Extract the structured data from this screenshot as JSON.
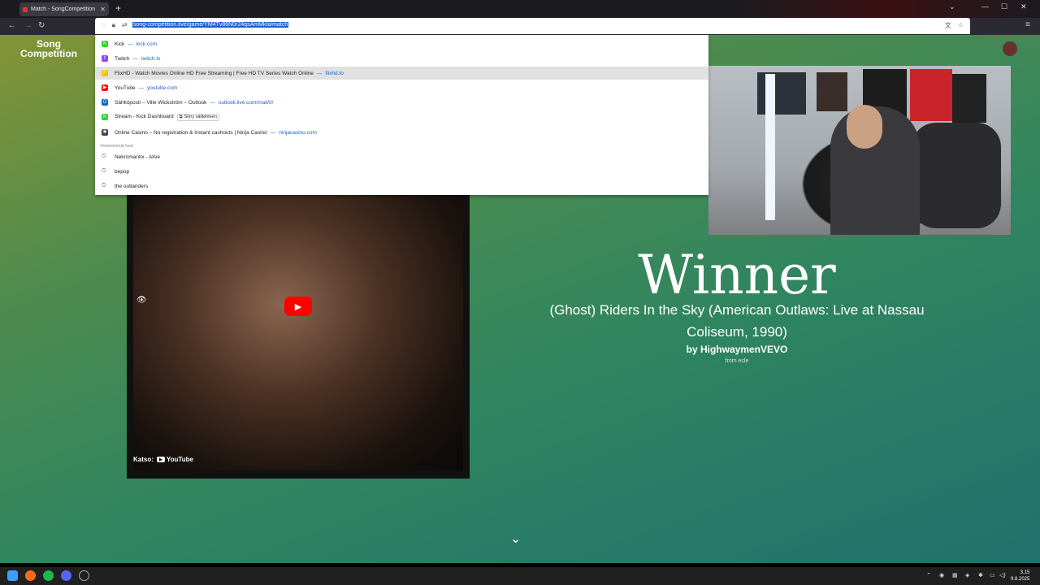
{
  "browser": {
    "tab_title": "Match - SongCompetition",
    "new_tab_symbol": "+",
    "url": "song-competition.live/game/YM4Tv86N0r24qsAmMkfa/match"
  },
  "site": {
    "logo_line1": "Song",
    "logo_line2": "Competition"
  },
  "dropdown": {
    "items": [
      {
        "title": "Kick",
        "sep": "—",
        "url": "kick.com",
        "icon": "kick-icon",
        "color": "#2fd52f"
      },
      {
        "title": "Twitch",
        "sep": "—",
        "url": "twitch.tv",
        "icon": "twitch-icon",
        "color": "#9146ff"
      },
      {
        "title": "FlixHD - Watch Movies Online HD Free Streaming | Free HD TV Series Watch Online",
        "sep": "—",
        "url": "flixhd.to",
        "icon": "flixhd-icon",
        "color": "#f2c200"
      },
      {
        "title": "YouTube",
        "sep": "—",
        "url": "youtube.com",
        "icon": "youtube-icon",
        "color": "#ff0000"
      },
      {
        "title": "Sähköposti – Ville Wickström – Outlook",
        "sep": "—",
        "url": "outlook.live.com/mail/0/",
        "icon": "outlook-icon",
        "color": "#0a64c8"
      },
      {
        "title": "Stream - Kick Dashboard",
        "chip": "Siirry välilehteen",
        "icon": "kick-icon",
        "color": "#2fd52f"
      },
      {
        "title": "Online Casino – No registration & Instant cashouts | Ninja Casino",
        "sep": "—",
        "url": "ninjacasino.com",
        "icon": "ninja-casino-icon",
        "color": "#444"
      }
    ],
    "section_label": "Viimeisimmät haut",
    "history": [
      "Nekromantix - Alive",
      "bepop",
      "the outlanders"
    ]
  },
  "video": {
    "watch_on": "Katso:",
    "platform": "YouTube"
  },
  "result": {
    "heading": "Winner",
    "song_title": "(Ghost) Riders In the Sky (American Outlaws: Live at Nassau Coliseum, 1990)",
    "artist": "by HighwaymenVEVO",
    "submitter": "from ecle"
  },
  "taskbar": {
    "time": "3.15",
    "date": "9.8.2025"
  }
}
